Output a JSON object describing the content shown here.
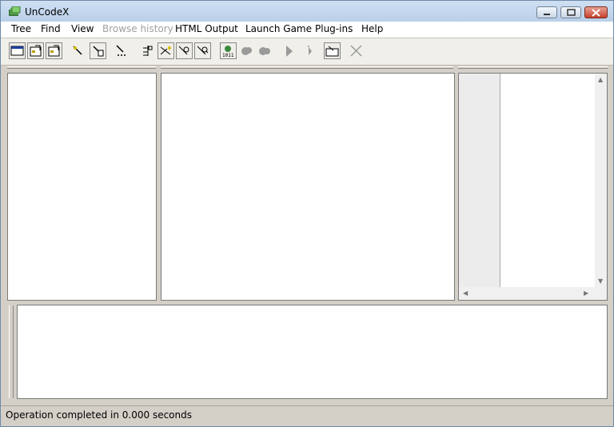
{
  "window": {
    "title": "UnCodeX"
  },
  "menu": [
    {
      "label": "Tree",
      "enabled": true
    },
    {
      "label": "Find",
      "enabled": true
    },
    {
      "label": "View",
      "enabled": true
    },
    {
      "label": "Browse history",
      "enabled": false
    },
    {
      "label": "HTML Output",
      "enabled": true
    },
    {
      "label": "Launch Game",
      "enabled": true
    },
    {
      "label": "Plug-ins",
      "enabled": true
    },
    {
      "label": "Help",
      "enabled": true
    }
  ],
  "toolbar": {
    "buttons": [
      "window-icon",
      "properties-icon",
      "properties-2-icon",
      "filter-icon",
      "filter-tree-icon",
      "filter-dots-icon",
      "tree-expand-icon",
      "tree-filter-icon",
      "tree-gear-icon",
      "tree-search-icon",
      "binary-gear-icon",
      "cloud-icon",
      "cloud-2-icon",
      "play-icon",
      "step-icon",
      "open-folder-icon",
      "close-x-icon"
    ]
  },
  "status": {
    "text": "Operation completed in 0.000 seconds"
  }
}
